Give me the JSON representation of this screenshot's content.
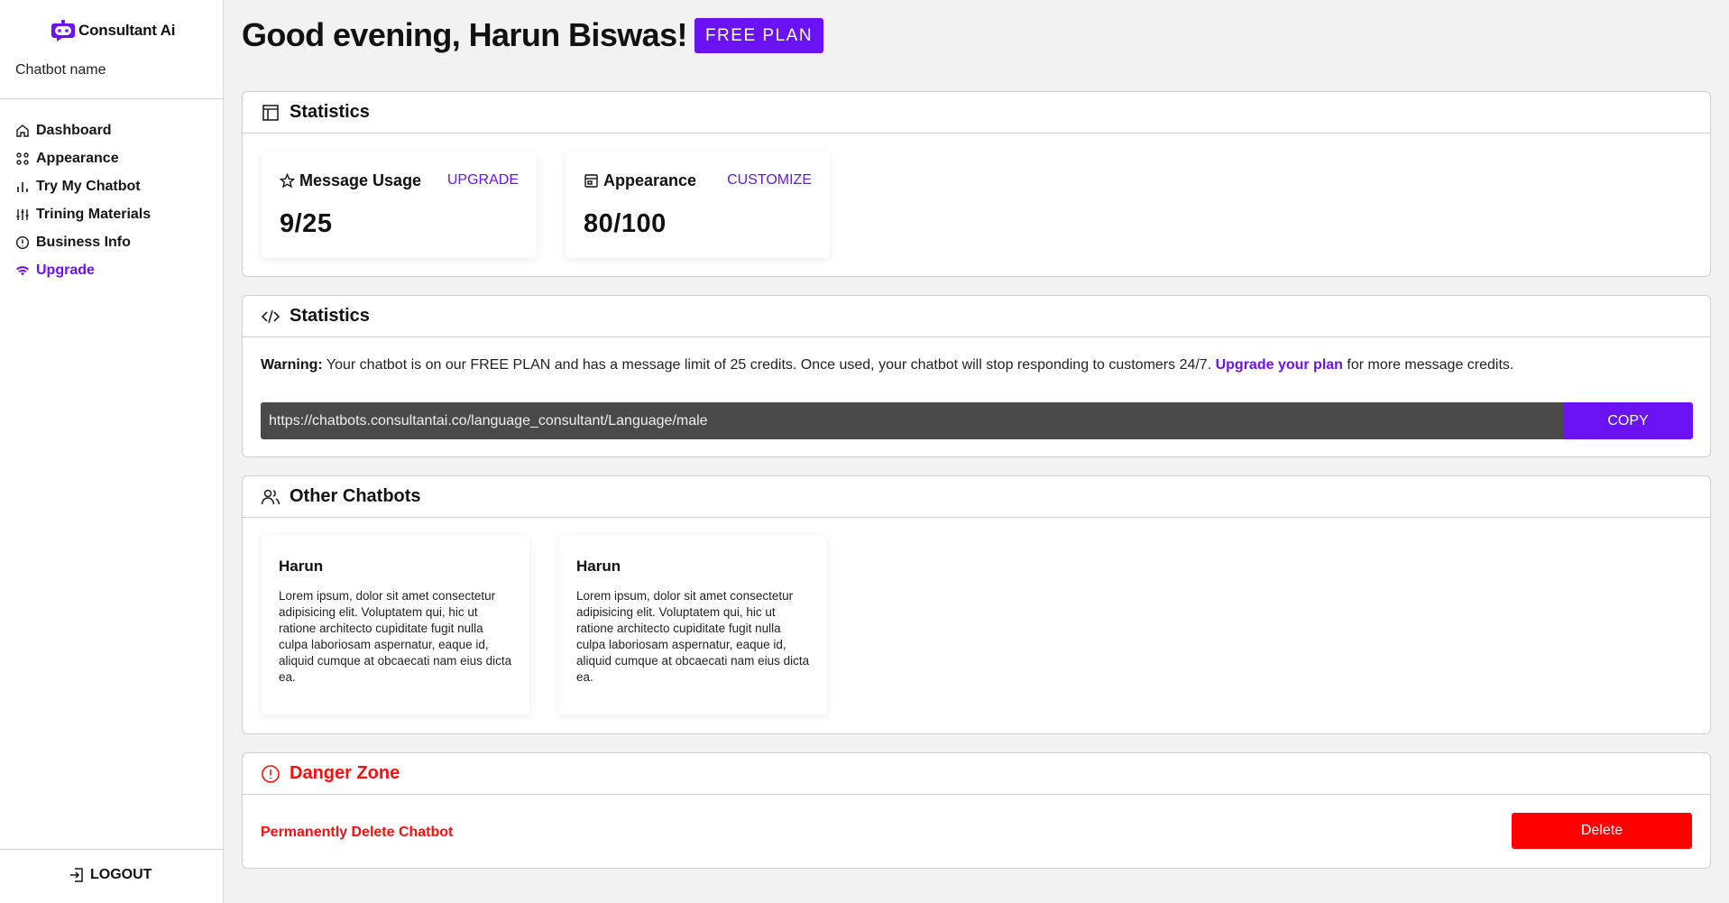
{
  "brand": {
    "name": "Consultant Ai",
    "logo_icon": "robot-chat-icon",
    "accent": "#6b12f5"
  },
  "sidebar": {
    "chatbot_name_label": "Chatbot name",
    "items": [
      {
        "label": "Dashboard",
        "icon": "home-icon",
        "active": false
      },
      {
        "label": "Appearance",
        "icon": "grid-icon",
        "active": false
      },
      {
        "label": "Try My Chatbot",
        "icon": "bar-chart-icon",
        "active": false
      },
      {
        "label": "Trining Materials",
        "icon": "sliders-icon",
        "active": false
      },
      {
        "label": "Business Info",
        "icon": "info-icon",
        "active": false
      },
      {
        "label": "Upgrade",
        "icon": "wifi-icon",
        "active": true
      }
    ],
    "logout_label": "LOGOUT"
  },
  "header": {
    "greeting": "Good evening, Harun Biswas!",
    "plan_badge": "FREE PLAN"
  },
  "statistics": {
    "title": "Statistics",
    "message_usage": {
      "label": "Message Usage",
      "action": "UPGRADE",
      "value": "9/25"
    },
    "appearance": {
      "label": "Appearance",
      "action": "CUSTOMIZE",
      "value": "80/100"
    }
  },
  "embed": {
    "title": "Statistics",
    "warning_prefix": "Warning:",
    "warning_text": " Your chatbot is on our FREE PLAN and has a message limit of 25 credits. Once used, your chatbot will stop responding to customers 24/7. ",
    "warning_link": "Upgrade your plan",
    "warning_suffix": " for more message credits.",
    "url": "https://chatbots.consultantai.co/language_consultant/Language/male",
    "copy_label": "COPY"
  },
  "other_chatbots": {
    "title": "Other Chatbots",
    "bots": [
      {
        "name": "Harun",
        "description": "Lorem ipsum, dolor sit amet consectetur adipisicing elit. Voluptatem qui, hic ut ratione architecto cupiditate fugit nulla culpa laboriosam aspernatur, eaque id, aliquid cumque at obcaecati nam eius dicta ea."
      },
      {
        "name": "Harun",
        "description": "Lorem ipsum, dolor sit amet consectetur adipisicing elit. Voluptatem qui, hic ut ratione architecto cupiditate fugit nulla culpa laboriosam aspernatur, eaque id, aliquid cumque at obcaecati nam eius dicta ea."
      }
    ]
  },
  "danger_zone": {
    "title": "Danger Zone",
    "text": "Permanently Delete Chatbot",
    "delete_label": "Delete",
    "color": "#ff0b0b"
  }
}
